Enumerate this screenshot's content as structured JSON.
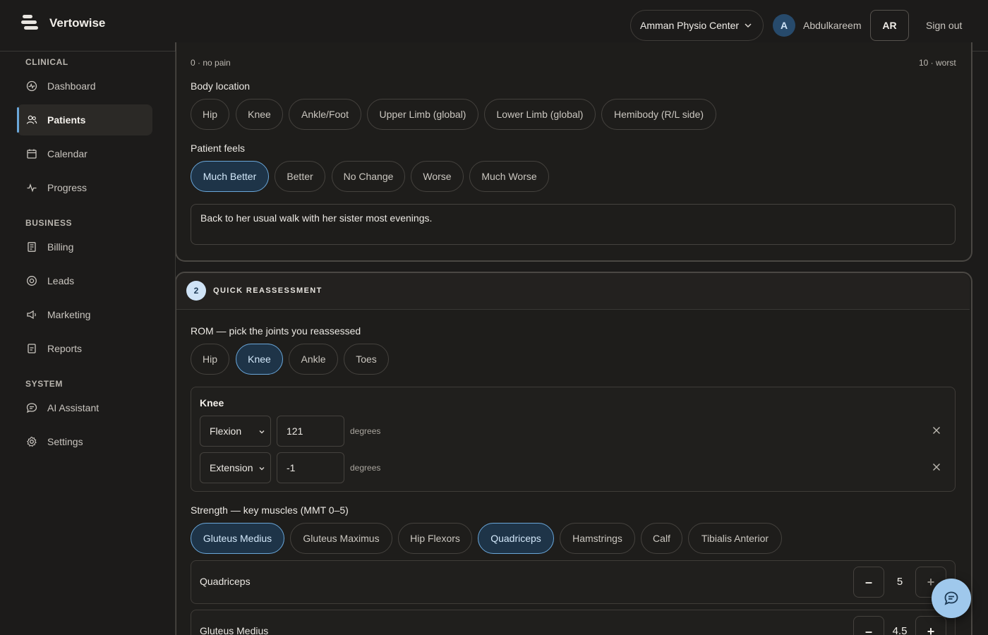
{
  "header": {
    "brand": "Vertowise",
    "clinic": "Amman Physio Center",
    "avatar_initial": "A",
    "username": "Abdulkareem",
    "lang_button": "AR",
    "sign_out": "Sign out"
  },
  "sidebar": {
    "sections": {
      "clinical": "CLINICAL",
      "business": "BUSINESS",
      "system": "SYSTEM"
    },
    "items": [
      {
        "label": "Dashboard",
        "icon": "dashboard-icon"
      },
      {
        "label": "Patients",
        "icon": "users-icon",
        "active": true
      },
      {
        "label": "Calendar",
        "icon": "calendar-icon"
      },
      {
        "label": "Progress",
        "icon": "activity-icon"
      },
      {
        "label": "Billing",
        "icon": "receipt-icon"
      },
      {
        "label": "Leads",
        "icon": "target-icon"
      },
      {
        "label": "Marketing",
        "icon": "megaphone-icon"
      },
      {
        "label": "Reports",
        "icon": "report-icon"
      },
      {
        "label": "AI Assistant",
        "icon": "chat-icon"
      },
      {
        "label": "Settings",
        "icon": "gear-icon"
      }
    ]
  },
  "pain": {
    "scale_min": "0 · no pain",
    "scale_max": "10 · worst"
  },
  "body_location": {
    "label": "Body location",
    "options": [
      "Hip",
      "Knee",
      "Ankle/Foot",
      "Upper Limb (global)",
      "Lower Limb (global)",
      "Hemibody (R/L side)"
    ]
  },
  "patient_feels": {
    "label": "Patient feels",
    "options": [
      "Much Better",
      "Better",
      "No Change",
      "Worse",
      "Much Worse"
    ],
    "selected": "Much Better"
  },
  "note": "Back to her usual walk with her sister most evenings.",
  "reassessment": {
    "step": "2",
    "title": "QUICK REASSESSMENT",
    "rom_label": "ROM — pick the joints you reassessed",
    "joints": [
      "Hip",
      "Knee",
      "Ankle",
      "Toes"
    ],
    "selected_joint": "Knee",
    "joint_panel": {
      "title": "Knee",
      "rows": [
        {
          "movement": "Flexion",
          "value": "121",
          "unit": "degrees"
        },
        {
          "movement": "Extension",
          "value": "-1",
          "unit": "degrees"
        }
      ]
    },
    "strength_label": "Strength — key muscles (MMT 0–5)",
    "muscles": [
      "Gluteus Medius",
      "Gluteus Maximus",
      "Hip Flexors",
      "Quadriceps",
      "Hamstrings",
      "Calf",
      "Tibialis Anterior"
    ],
    "selected_muscles": [
      "Gluteus Medius",
      "Quadriceps"
    ],
    "mmt": [
      {
        "name": "Quadriceps",
        "value": "5",
        "minus": "–",
        "plus": "+"
      },
      {
        "name": "Gluteus Medius",
        "value": "4.5",
        "minus": "–",
        "plus": "+"
      }
    ]
  },
  "colors": {
    "accent": "#6aa7da",
    "selected_fill": "#1e3448",
    "background": "#1c1b1a"
  }
}
